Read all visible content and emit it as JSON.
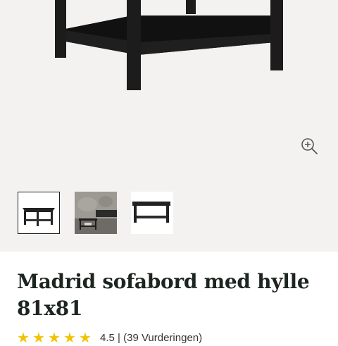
{
  "product": {
    "title_line1": "Madrid sofabord med hylle",
    "title_line2": "81x81",
    "rating_value": "4.5",
    "rating_count_text": "(39 Vurderingen)",
    "rating_separator": "|"
  },
  "gallery": {
    "zoom_icon": "zoom-in-icon",
    "thumbnails": [
      {
        "name": "table-front-view",
        "active": true
      },
      {
        "name": "table-room-scene",
        "active": false
      },
      {
        "name": "table-side-view",
        "active": false
      }
    ]
  },
  "colors": {
    "star": "#f2c200",
    "gallery_bg": "#f3f2f1",
    "table": "#1e1e1e"
  }
}
